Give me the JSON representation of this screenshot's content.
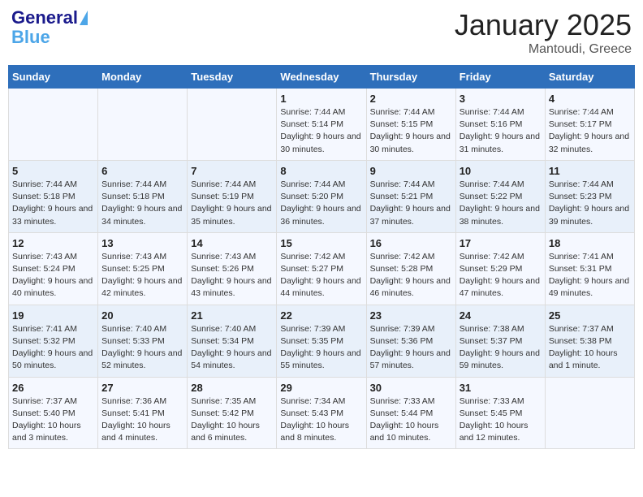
{
  "header": {
    "logo_line1": "General",
    "logo_line2": "Blue",
    "month": "January 2025",
    "location": "Mantoudi, Greece"
  },
  "weekdays": [
    "Sunday",
    "Monday",
    "Tuesday",
    "Wednesday",
    "Thursday",
    "Friday",
    "Saturday"
  ],
  "weeks": [
    [
      {
        "day": "",
        "info": ""
      },
      {
        "day": "",
        "info": ""
      },
      {
        "day": "",
        "info": ""
      },
      {
        "day": "1",
        "info": "Sunrise: 7:44 AM\nSunset: 5:14 PM\nDaylight: 9 hours and 30 minutes."
      },
      {
        "day": "2",
        "info": "Sunrise: 7:44 AM\nSunset: 5:15 PM\nDaylight: 9 hours and 30 minutes."
      },
      {
        "day": "3",
        "info": "Sunrise: 7:44 AM\nSunset: 5:16 PM\nDaylight: 9 hours and 31 minutes."
      },
      {
        "day": "4",
        "info": "Sunrise: 7:44 AM\nSunset: 5:17 PM\nDaylight: 9 hours and 32 minutes."
      }
    ],
    [
      {
        "day": "5",
        "info": "Sunrise: 7:44 AM\nSunset: 5:18 PM\nDaylight: 9 hours and 33 minutes."
      },
      {
        "day": "6",
        "info": "Sunrise: 7:44 AM\nSunset: 5:18 PM\nDaylight: 9 hours and 34 minutes."
      },
      {
        "day": "7",
        "info": "Sunrise: 7:44 AM\nSunset: 5:19 PM\nDaylight: 9 hours and 35 minutes."
      },
      {
        "day": "8",
        "info": "Sunrise: 7:44 AM\nSunset: 5:20 PM\nDaylight: 9 hours and 36 minutes."
      },
      {
        "day": "9",
        "info": "Sunrise: 7:44 AM\nSunset: 5:21 PM\nDaylight: 9 hours and 37 minutes."
      },
      {
        "day": "10",
        "info": "Sunrise: 7:44 AM\nSunset: 5:22 PM\nDaylight: 9 hours and 38 minutes."
      },
      {
        "day": "11",
        "info": "Sunrise: 7:44 AM\nSunset: 5:23 PM\nDaylight: 9 hours and 39 minutes."
      }
    ],
    [
      {
        "day": "12",
        "info": "Sunrise: 7:43 AM\nSunset: 5:24 PM\nDaylight: 9 hours and 40 minutes."
      },
      {
        "day": "13",
        "info": "Sunrise: 7:43 AM\nSunset: 5:25 PM\nDaylight: 9 hours and 42 minutes."
      },
      {
        "day": "14",
        "info": "Sunrise: 7:43 AM\nSunset: 5:26 PM\nDaylight: 9 hours and 43 minutes."
      },
      {
        "day": "15",
        "info": "Sunrise: 7:42 AM\nSunset: 5:27 PM\nDaylight: 9 hours and 44 minutes."
      },
      {
        "day": "16",
        "info": "Sunrise: 7:42 AM\nSunset: 5:28 PM\nDaylight: 9 hours and 46 minutes."
      },
      {
        "day": "17",
        "info": "Sunrise: 7:42 AM\nSunset: 5:29 PM\nDaylight: 9 hours and 47 minutes."
      },
      {
        "day": "18",
        "info": "Sunrise: 7:41 AM\nSunset: 5:31 PM\nDaylight: 9 hours and 49 minutes."
      }
    ],
    [
      {
        "day": "19",
        "info": "Sunrise: 7:41 AM\nSunset: 5:32 PM\nDaylight: 9 hours and 50 minutes."
      },
      {
        "day": "20",
        "info": "Sunrise: 7:40 AM\nSunset: 5:33 PM\nDaylight: 9 hours and 52 minutes."
      },
      {
        "day": "21",
        "info": "Sunrise: 7:40 AM\nSunset: 5:34 PM\nDaylight: 9 hours and 54 minutes."
      },
      {
        "day": "22",
        "info": "Sunrise: 7:39 AM\nSunset: 5:35 PM\nDaylight: 9 hours and 55 minutes."
      },
      {
        "day": "23",
        "info": "Sunrise: 7:39 AM\nSunset: 5:36 PM\nDaylight: 9 hours and 57 minutes."
      },
      {
        "day": "24",
        "info": "Sunrise: 7:38 AM\nSunset: 5:37 PM\nDaylight: 9 hours and 59 minutes."
      },
      {
        "day": "25",
        "info": "Sunrise: 7:37 AM\nSunset: 5:38 PM\nDaylight: 10 hours and 1 minute."
      }
    ],
    [
      {
        "day": "26",
        "info": "Sunrise: 7:37 AM\nSunset: 5:40 PM\nDaylight: 10 hours and 3 minutes."
      },
      {
        "day": "27",
        "info": "Sunrise: 7:36 AM\nSunset: 5:41 PM\nDaylight: 10 hours and 4 minutes."
      },
      {
        "day": "28",
        "info": "Sunrise: 7:35 AM\nSunset: 5:42 PM\nDaylight: 10 hours and 6 minutes."
      },
      {
        "day": "29",
        "info": "Sunrise: 7:34 AM\nSunset: 5:43 PM\nDaylight: 10 hours and 8 minutes."
      },
      {
        "day": "30",
        "info": "Sunrise: 7:33 AM\nSunset: 5:44 PM\nDaylight: 10 hours and 10 minutes."
      },
      {
        "day": "31",
        "info": "Sunrise: 7:33 AM\nSunset: 5:45 PM\nDaylight: 10 hours and 12 minutes."
      },
      {
        "day": "",
        "info": ""
      }
    ]
  ]
}
